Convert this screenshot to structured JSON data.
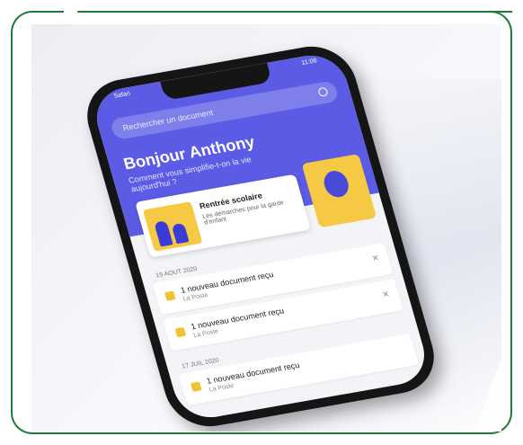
{
  "colors": {
    "frame_green": "#1f7a3a",
    "brand_purple": "#5b5be6",
    "accent_yellow": "#f6c945"
  },
  "status_bar": {
    "left": "Safari",
    "right": "11:08"
  },
  "search": {
    "placeholder": "Rechercher un document"
  },
  "greeting": {
    "title": "Bonjour Anthony",
    "subtitle": "Comment vous simplifie-t-on la vie aujourd'hui ?"
  },
  "hero_card": {
    "title": "Rentrée scolaire",
    "subtitle": "Les démarches pour la garde d'enfant"
  },
  "feed": [
    {
      "date": "19 AOUT 2020",
      "items": [
        {
          "title": "1 nouveau document reçu",
          "source": "La Poste"
        },
        {
          "title": "1 nouveau document reçu",
          "source": "La Poste"
        }
      ]
    },
    {
      "date": "17 JUIL 2020",
      "items": [
        {
          "title": "1 nouveau document reçu",
          "source": "La Poste"
        }
      ]
    }
  ],
  "icons": [
    "search-icon",
    "close-icon",
    "document-icon",
    "lightbulb-icon"
  ]
}
